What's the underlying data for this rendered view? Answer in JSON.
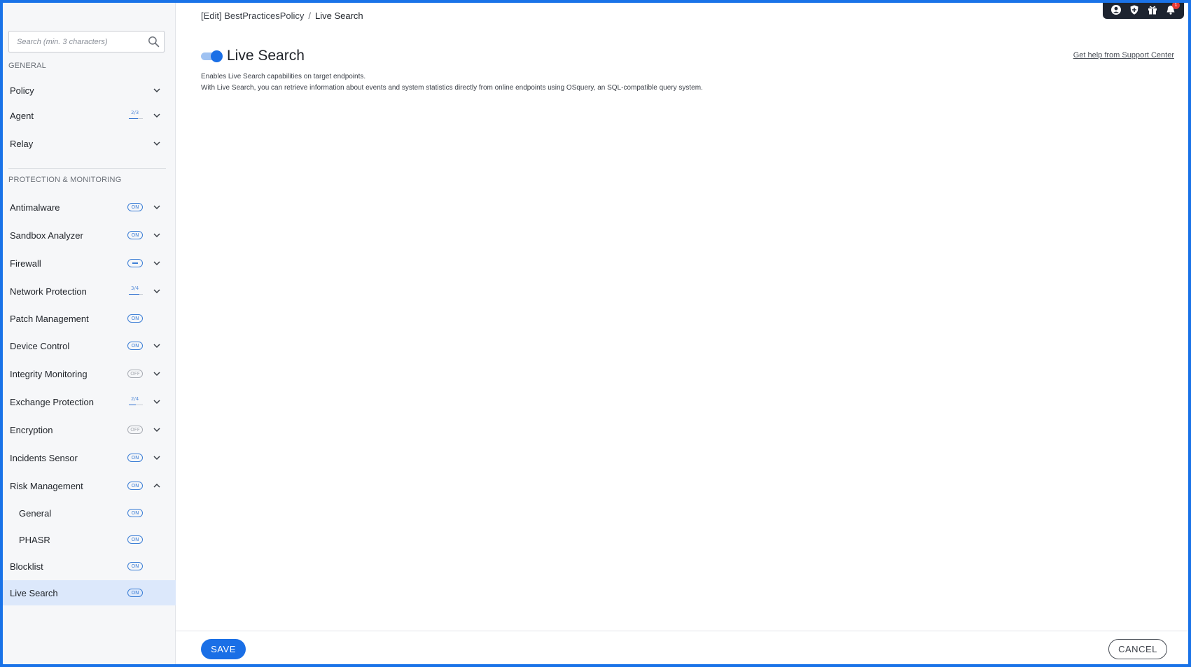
{
  "breadcrumb": {
    "parent": "[Edit] BestPracticesPolicy",
    "separator": "/",
    "current": "Live Search"
  },
  "top_icons": {
    "items": [
      "user-icon",
      "shield-icon",
      "gift-icon",
      "bell-icon"
    ],
    "notification_count": "1"
  },
  "sidebar": {
    "search": {
      "placeholder": "Search (min. 3 characters)",
      "value": ""
    },
    "sections": {
      "general": "GENERAL",
      "protection": "PROTECTION & MONITORING"
    },
    "items": [
      {
        "label": "Policy",
        "status": "",
        "chevron": "down"
      },
      {
        "label": "Agent",
        "status": "2/3",
        "chevron": "down"
      },
      {
        "label": "Relay",
        "status": "",
        "chevron": "down"
      },
      {
        "label": "Antimalware",
        "status": "ON",
        "chevron": "down"
      },
      {
        "label": "Sandbox Analyzer",
        "status": "ON",
        "chevron": "down"
      },
      {
        "label": "Firewall",
        "status": "partial",
        "chevron": "down"
      },
      {
        "label": "Network Protection",
        "status": "3/4",
        "chevron": "down"
      },
      {
        "label": "Patch Management",
        "status": "ON",
        "chevron": ""
      },
      {
        "label": "Device Control",
        "status": "ON",
        "chevron": "down"
      },
      {
        "label": "Integrity Monitoring",
        "status": "OFF",
        "chevron": "down"
      },
      {
        "label": "Exchange Protection",
        "status": "2/4",
        "chevron": "down"
      },
      {
        "label": "Encryption",
        "status": "OFF",
        "chevron": "down"
      },
      {
        "label": "Incidents Sensor",
        "status": "ON",
        "chevron": "down"
      },
      {
        "label": "Risk Management",
        "status": "ON",
        "chevron": "up"
      },
      {
        "label": "General",
        "status": "ON",
        "chevron": ""
      },
      {
        "label": "PHASR",
        "status": "ON",
        "chevron": ""
      },
      {
        "label": "Blocklist",
        "status": "ON",
        "chevron": ""
      },
      {
        "label": "Live Search",
        "status": "ON",
        "chevron": ""
      }
    ],
    "active_item": "Live Search"
  },
  "main": {
    "toggle_enabled": true,
    "title": "Live Search",
    "help_link": "Get help from Support Center",
    "description_line1": "Enables Live Search capabilities on target endpoints.",
    "description_line2": "With Live Search, you can retrieve information about events and system statistics directly from online endpoints using OSquery, an SQL-compatible query system."
  },
  "footer": {
    "save_label": "SAVE",
    "cancel_label": "CANCEL"
  },
  "colors": {
    "accent": "#1a6fe6",
    "frame": "#1a73e8",
    "active_row": "#dce8fb",
    "sidebar_bg": "#f6f7f9"
  }
}
